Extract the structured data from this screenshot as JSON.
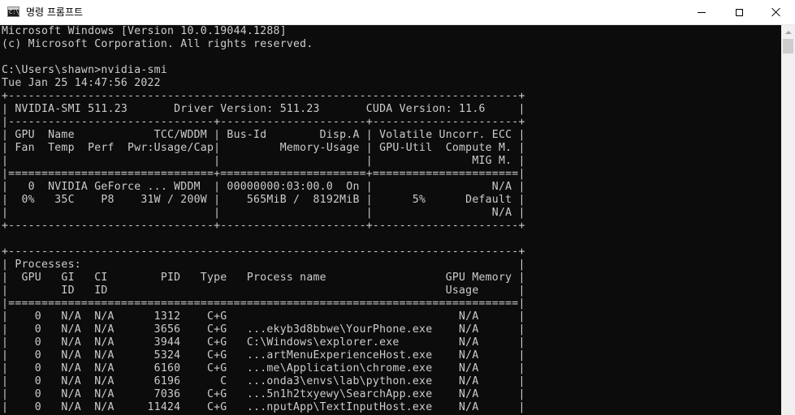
{
  "window": {
    "title": "명령 프롬프트",
    "icon": "cmd-icon",
    "controls": {
      "minimize": "minimize-icon",
      "maximize": "maximize-icon",
      "close": "close-icon"
    }
  },
  "console": {
    "lines": [
      "Microsoft Windows [Version 10.0.19044.1288]",
      "(c) Microsoft Corporation. All rights reserved.",
      "",
      "C:\\Users\\shawn>nvidia-smi",
      "Tue Jan 25 14:47:56 2022",
      "+-----------------------------------------------------------------------------+",
      "| NVIDIA-SMI 511.23       Driver Version: 511.23       CUDA Version: 11.6     |",
      "|-------------------------------+----------------------+----------------------+",
      "| GPU  Name            TCC/WDDM | Bus-Id        Disp.A | Volatile Uncorr. ECC |",
      "| Fan  Temp  Perf  Pwr:Usage/Cap|         Memory-Usage | GPU-Util  Compute M. |",
      "|                               |                      |               MIG M. |",
      "|===============================+======================+======================|",
      "|   0  NVIDIA GeForce ... WDDM  | 00000000:03:00.0  On |                  N/A |",
      "|  0%   35C    P8    31W / 200W |    565MiB /  8192MiB |      5%      Default |",
      "|                               |                      |                  N/A |",
      "+-------------------------------+----------------------+----------------------+",
      "",
      "+-----------------------------------------------------------------------------+",
      "| Processes:                                                                  |",
      "|  GPU   GI   CI        PID   Type   Process name                  GPU Memory |",
      "|        ID   ID                                                   Usage      |",
      "|=============================================================================|",
      "|    0   N/A  N/A      1312    C+G                                   N/A      |",
      "|    0   N/A  N/A      3656    C+G   ...ekyb3d8bbwe\\YourPhone.exe    N/A      |",
      "|    0   N/A  N/A      3944    C+G   C:\\Windows\\explorer.exe         N/A      |",
      "|    0   N/A  N/A      5324    C+G   ...artMenuExperienceHost.exe    N/A      |",
      "|    0   N/A  N/A      6160    C+G   ...me\\Application\\chrome.exe    N/A      |",
      "|    0   N/A  N/A      6196      C   ...onda3\\envs\\lab\\python.exe    N/A      |",
      "|    0   N/A  N/A      7036    C+G   ...5n1h2txyewy\\SearchApp.exe    N/A      |",
      "|    0   N/A  N/A     11424    C+G   ...nputApp\\TextInputHost.exe    N/A      |"
    ]
  },
  "colors": {
    "console_bg": "#0c0c0c",
    "console_text": "#cccccc",
    "titlebar_bg": "#ffffff",
    "scrollbar_bg": "#f0f0f0",
    "scrollbar_thumb": "#cdcdcd"
  }
}
